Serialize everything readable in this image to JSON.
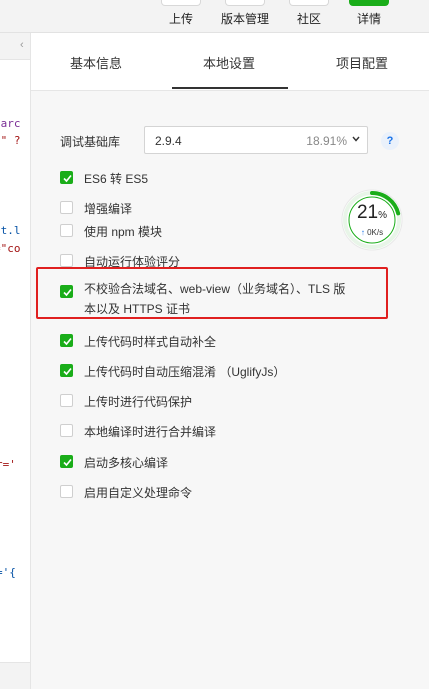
{
  "toolbar": {
    "upload_label": "上传",
    "version_label": "版本管理",
    "community_label": "社区",
    "details_label": "详情"
  },
  "editor": {
    "tab_text": "‹",
    "code_lines": [
      {
        "text": "earc",
        "color": "#7b2e96"
      },
      {
        "text": "n\" ?",
        "color": "#a31515"
      },
      {
        "text": "st.l",
        "color": "#0451a5"
      },
      {
        "text": "=\"co",
        "color": "#a31515"
      },
      {
        "text": "r='",
        "color": "#a31515"
      },
      {
        "text": "='{",
        "color": "#0451a5"
      }
    ]
  },
  "panel": {
    "tabs": [
      {
        "label": "基本信息"
      },
      {
        "label": "本地设置"
      },
      {
        "label": "项目配置"
      }
    ],
    "active_tab": "本地设置",
    "debug_lib": {
      "label": "调试基础库",
      "version": "2.9.4",
      "percent": "18.91%",
      "help": "?"
    },
    "options": [
      {
        "label": "ES6 转 ES5",
        "checked": true
      },
      {
        "label": "增强编译",
        "checked": false
      },
      {
        "label": "使用 npm 模块",
        "checked": false
      },
      {
        "label": "自动运行体验评分",
        "checked": false
      },
      {
        "label_line1": "不校验合法域名、web-view（业务域名）、TLS 版",
        "label_line2": "本以及 HTTPS 证书",
        "checked": true
      },
      {
        "label": "上传代码时样式自动补全",
        "checked": true
      },
      {
        "label": "上传代码时自动压缩混淆 （UglifyJs）",
        "checked": true
      },
      {
        "label": "上传时进行代码保护",
        "checked": false
      },
      {
        "label": "本地编译时进行合并编译",
        "checked": false
      },
      {
        "label": "启动多核心编译",
        "checked": true
      },
      {
        "label": "启用自定义处理命令",
        "checked": false
      }
    ]
  },
  "gauge": {
    "value": "21",
    "unit": "%",
    "arrow": "↑",
    "speed": "0K/s",
    "fill_fraction": 0.21,
    "color": "#1aad19"
  },
  "colors": {
    "accent_green": "#1aad19",
    "highlight_red": "#e02020",
    "help_blue": "#1a73e8"
  }
}
